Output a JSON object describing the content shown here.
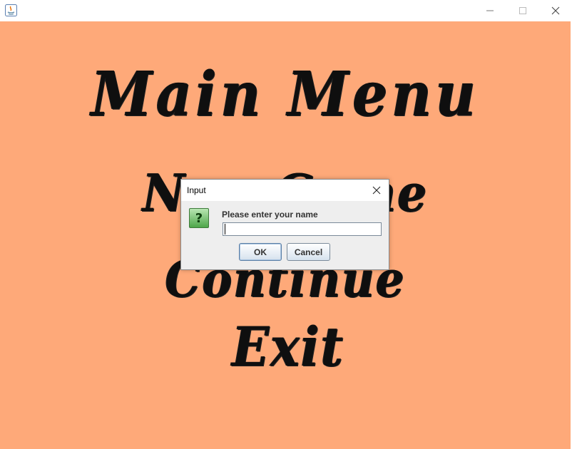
{
  "window": {
    "title": "",
    "controls": {
      "minimize": "minimize-icon",
      "maximize": "maximize-icon",
      "close": "close-icon"
    }
  },
  "menu": {
    "title": "Main Menu",
    "items": [
      "New Game",
      "Continue",
      "Exit"
    ]
  },
  "dialog": {
    "title": "Input",
    "prompt": "Please enter your name",
    "input_value": "",
    "ok_label": "OK",
    "cancel_label": "Cancel",
    "icon": "question-icon"
  },
  "colors": {
    "background": "#fea979",
    "menu_text": "#0f0f0f",
    "dialog_bg": "#eeeeee"
  }
}
